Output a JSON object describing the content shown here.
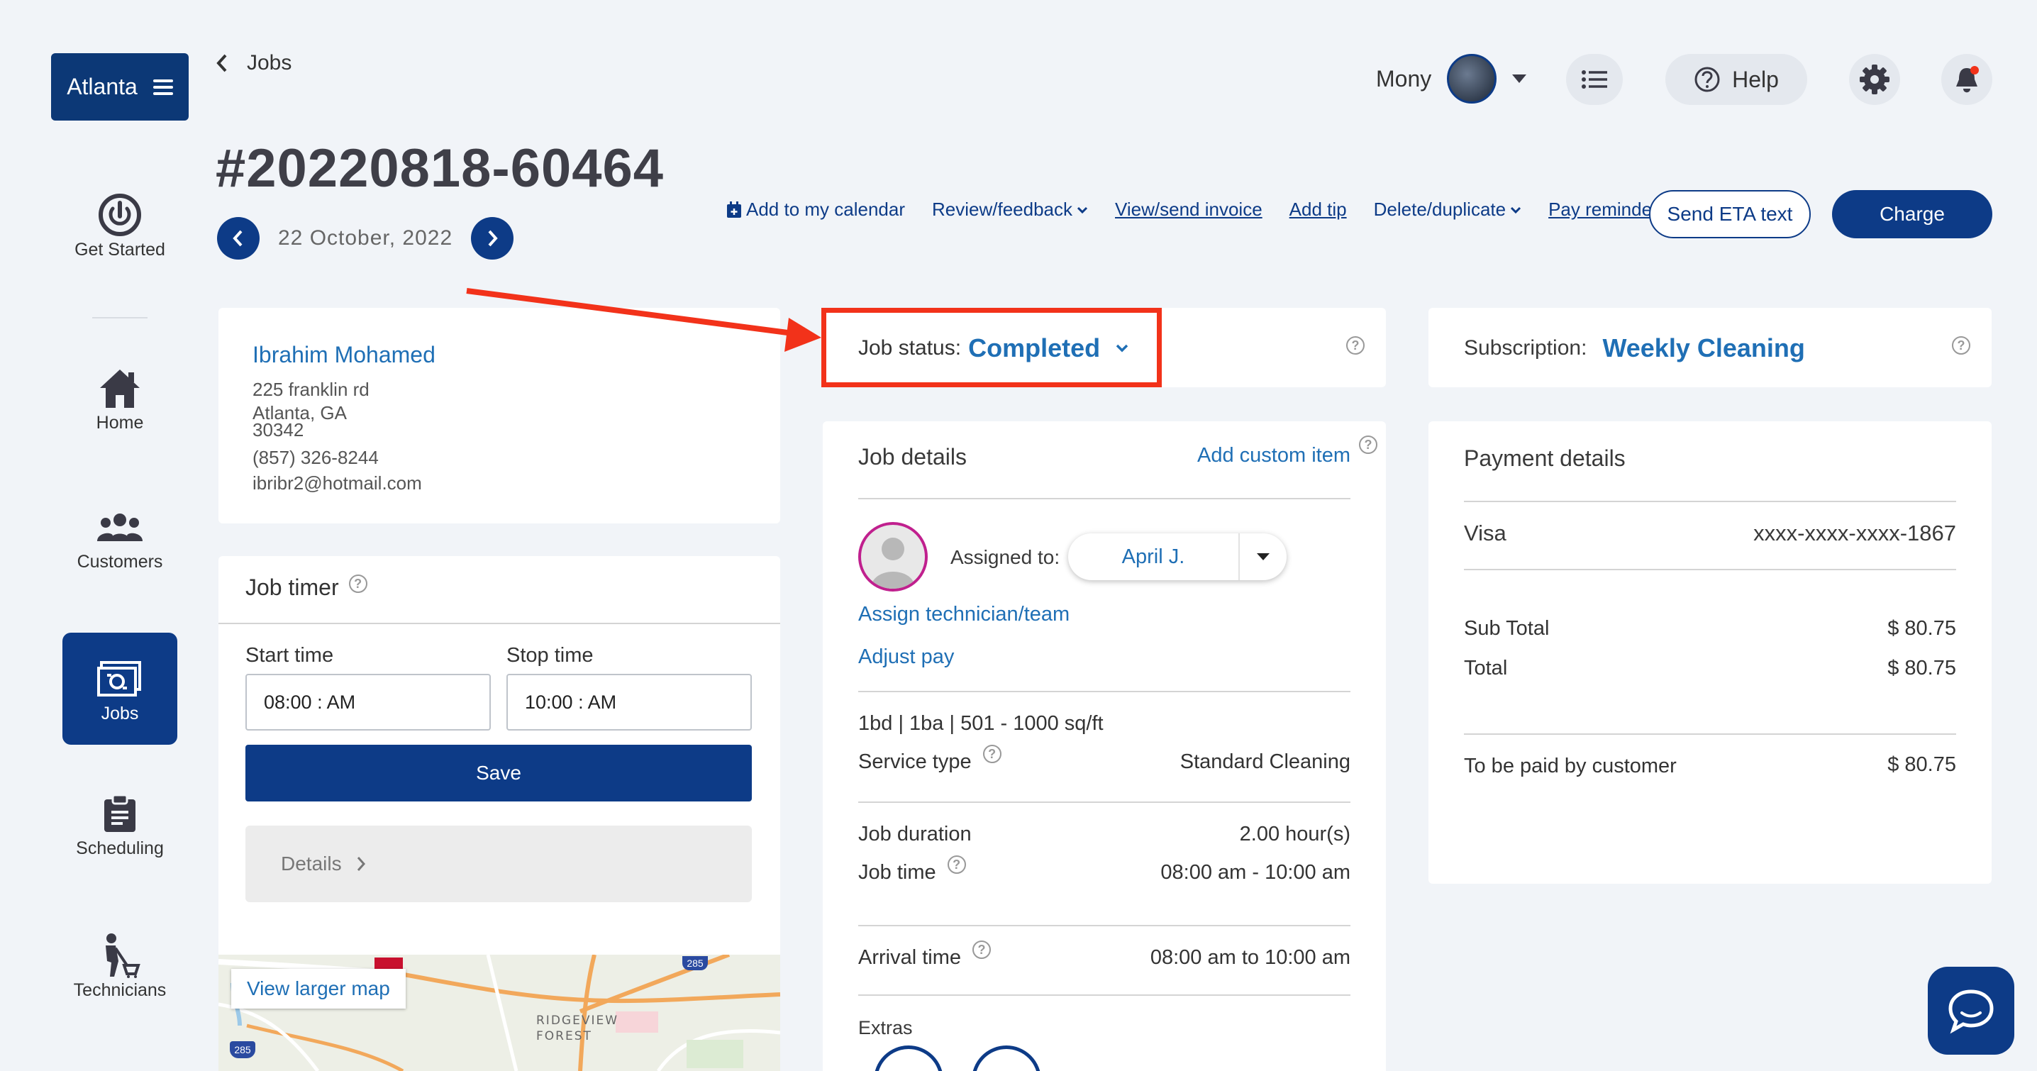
{
  "sidebar": {
    "brand": "Atlanta",
    "items": [
      {
        "label": "Get Started",
        "icon": "power-icon"
      },
      {
        "label": "Home",
        "icon": "home-icon"
      },
      {
        "label": "Customers",
        "icon": "customers-icon"
      },
      {
        "label": "Jobs",
        "icon": "jobs-icon",
        "active": true
      },
      {
        "label": "Scheduling",
        "icon": "clipboard-icon"
      },
      {
        "label": "Technicians",
        "icon": "technician-icon"
      }
    ]
  },
  "header": {
    "breadcrumb": "Jobs",
    "job_number": "#20220818-60464",
    "date": "22 October, 2022",
    "user_name": "Mony",
    "help_label": "Help"
  },
  "actions": {
    "add_calendar": "Add to my calendar",
    "review": "Review/feedback",
    "invoice": "View/send invoice",
    "tip": "Add tip",
    "delete_duplicate": "Delete/duplicate",
    "pay_reminder": "Pay reminder text",
    "send_eta": "Send ETA text",
    "charge": "Charge"
  },
  "customer": {
    "name": "Ibrahim Mohamed",
    "street": "225 franklin rd",
    "city_state": "Atlanta, GA",
    "zip": "30342",
    "phone": "(857) 326-8244",
    "email": "ibribr2@hotmail.com"
  },
  "job_timer": {
    "title": "Job timer",
    "start_label": "Start time",
    "stop_label": "Stop time",
    "start_value": "08:00 : AM",
    "stop_value": "10:00 : AM",
    "save_label": "Save",
    "details_label": "Details"
  },
  "map": {
    "view_larger": "View larger map",
    "place": "RIDGEVIEW\nFOREST",
    "shield_285_top": "285",
    "shield_285_bottom": "285"
  },
  "job_status": {
    "label": "Job status:",
    "value": "Completed"
  },
  "job_details": {
    "title": "Job details",
    "add_custom": "Add custom item",
    "assigned_label": "Assigned to:",
    "assigned_value": "April J.",
    "assign_link": "Assign technician/team",
    "adjust_pay": "Adjust pay",
    "size": "1bd | 1ba | 501 - 1000 sq/ft",
    "service_type_label": "Service type",
    "service_type_value": "Standard Cleaning",
    "duration_label": "Job duration",
    "duration_value": "2.00 hour(s)",
    "job_time_label": "Job time",
    "job_time_value": "08:00 am - 10:00 am",
    "arrival_label": "Arrival time",
    "arrival_value": "08:00 am to 10:00 am",
    "extras_label": "Extras"
  },
  "subscription": {
    "label": "Subscription:",
    "value": "Weekly Cleaning"
  },
  "payment": {
    "title": "Payment details",
    "card_type": "Visa",
    "card_number": "xxxx-xxxx-xxxx-1867",
    "subtotal_label": "Sub Total",
    "subtotal_value": "$ 80.75",
    "total_label": "Total",
    "total_value": "$ 80.75",
    "to_be_paid_label": "To be paid by customer",
    "to_be_paid_value": "$ 80.75"
  },
  "colors": {
    "primary": "#0d3b87",
    "link": "#1f6fb5",
    "annotation": "#f2321a",
    "background": "#f1f4f8"
  }
}
